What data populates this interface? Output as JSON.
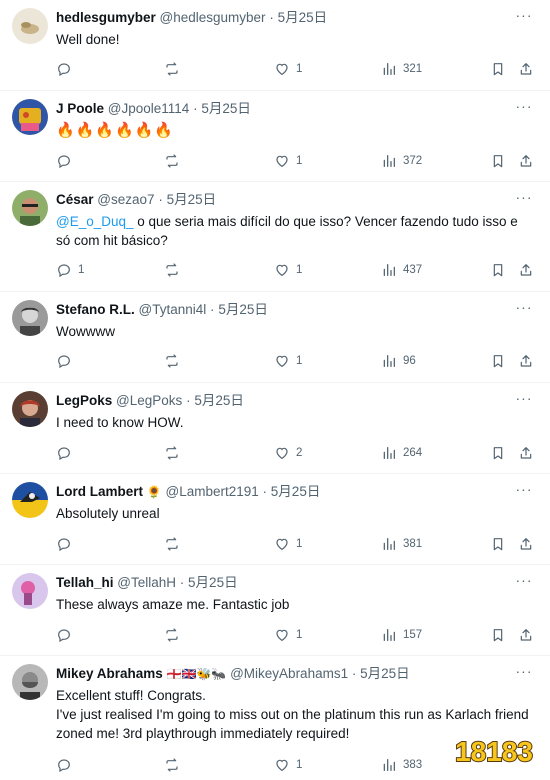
{
  "replies": [
    {
      "name": "hedlesgumyber",
      "handle": "@hedlesgumyber",
      "date": "5月25日",
      "text": "Well done!",
      "replies": "",
      "likes": "1",
      "views": "321",
      "avatar_color": "#e8e0d0"
    },
    {
      "name": "J Poole",
      "handle": "@Jpoole1114",
      "date": "5月25日",
      "text": "🔥🔥🔥🔥🔥🔥",
      "replies": "",
      "likes": "1",
      "views": "372",
      "avatar_color": "#3a5aa8"
    },
    {
      "name": "César",
      "handle": "@sezao7",
      "date": "5月25日",
      "mention": "@E_o_Duq_",
      "text": " o que seria mais difícil do que isso? Vencer fazendo tudo isso e só com hit básico?",
      "replies": "1",
      "likes": "1",
      "views": "437",
      "avatar_color": "#7a9a5a"
    },
    {
      "name": "Stefano R.L.",
      "handle": "@Tytanni4l",
      "date": "5月25日",
      "text": "Wowwww",
      "replies": "",
      "likes": "1",
      "views": "96",
      "avatar_color": "#888888"
    },
    {
      "name": "LegPoks",
      "handle": "@LegPoks",
      "date": "5月25日",
      "text": "I need to know HOW.",
      "replies": "",
      "likes": "2",
      "views": "264",
      "avatar_color": "#6a4a3a"
    },
    {
      "name": "Lord Lambert",
      "name_emoji": "🌻",
      "handle": "@Lambert2191",
      "date": "5月25日",
      "text": "Absolutely unreal",
      "replies": "",
      "likes": "1",
      "views": "381",
      "avatar_color": "#1f4fa0"
    },
    {
      "name": "Tellah_hi",
      "handle": "@TellahH",
      "date": "5月25日",
      "text": "These always amaze me. Fantastic job",
      "replies": "",
      "likes": "1",
      "views": "157",
      "avatar_color": "#c9a8e0"
    },
    {
      "name": "Mikey Abrahams",
      "name_emoji": "🏴󠁧󠁢󠁥󠁮󠁧󠁿🇬🇧🐝🐜",
      "handle": "@MikeyAbrahams1",
      "date": "5月25日",
      "text": "Excellent stuff! Congrats.\nI've just realised I'm going to miss out on the platinum this run as Karlach friend zoned me! 3rd playthrough immediately required!",
      "replies": "",
      "likes": "1",
      "views": "383",
      "avatar_color": "#8a8a8a"
    }
  ],
  "watermark": "18183",
  "icons": {
    "reply": "reply-icon",
    "retweet": "retweet-icon",
    "like": "heart-icon",
    "views": "views-icon",
    "bookmark": "bookmark-icon",
    "share": "share-icon",
    "more": "more-icon"
  }
}
